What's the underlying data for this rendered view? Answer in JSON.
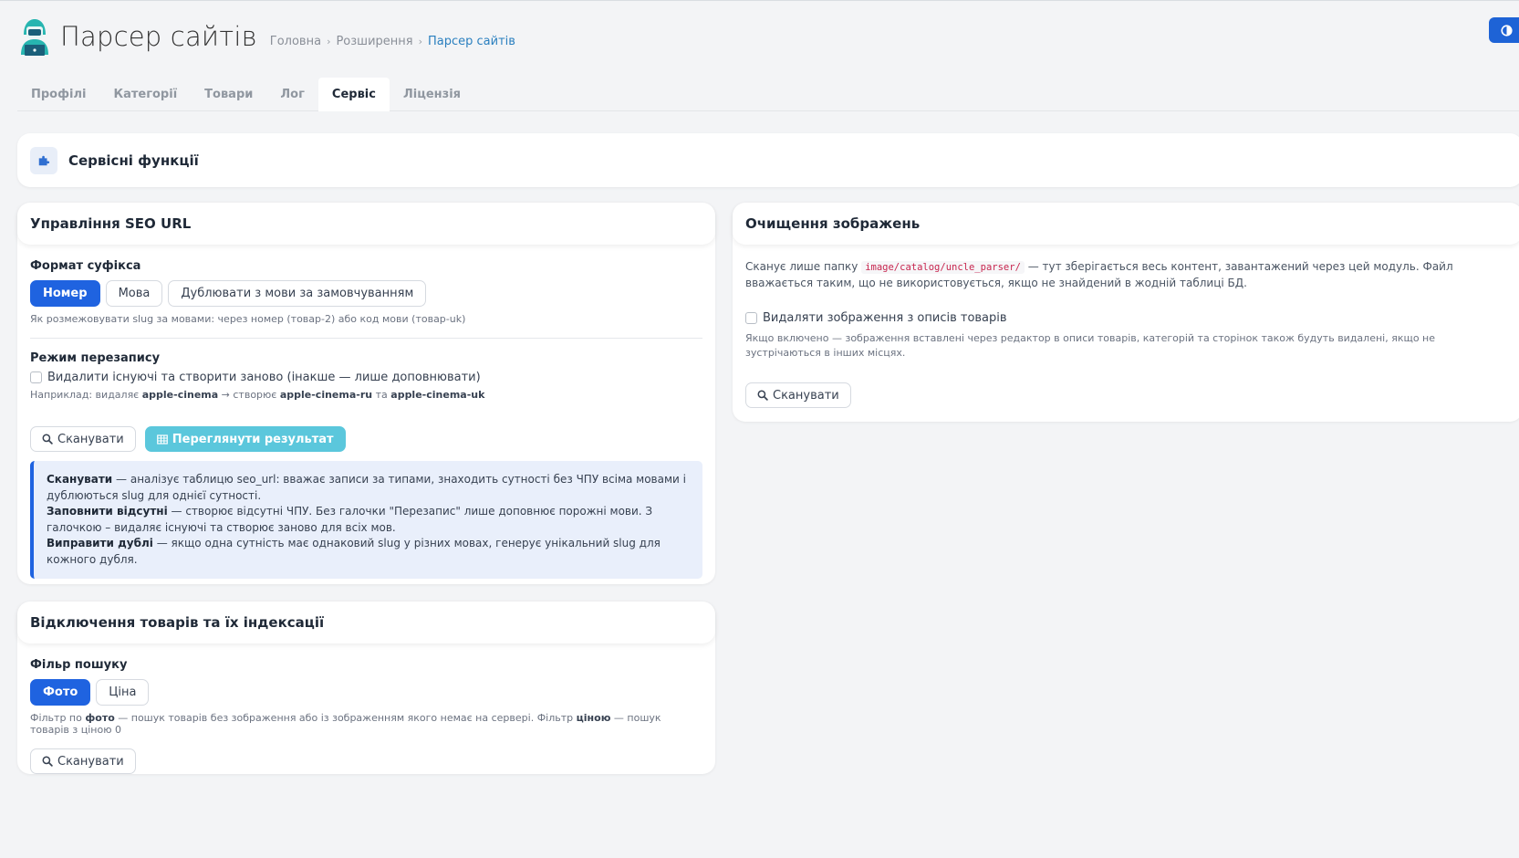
{
  "header": {
    "app_title": "Парсер сайтів",
    "breadcrumb": [
      "Головна",
      "Розширення",
      "Парсер сайтів"
    ]
  },
  "tabs": [
    "Профілі",
    "Категорії",
    "Товари",
    "Лог",
    "Сервіс",
    "Ліцензія"
  ],
  "active_tab": "Сервіс",
  "service": {
    "title": "Сервісні функції"
  },
  "seo": {
    "title": "Управління SEO URL",
    "suffix_label": "Формат суфікса",
    "suffix_options": [
      "Номер",
      "Мова",
      "Дублювати з мови за замовчуванням"
    ],
    "suffix_selected": "Номер",
    "suffix_help": "Як розмежовувати slug за мовами: через номер (товар-2) або код мови (товар-uk)",
    "overwrite_label": "Режим перезапису",
    "overwrite_checkbox": "Видалити існуючі та створити заново (інакше — лише доповнювати)",
    "example_prefix": "Наприклад: видаляє",
    "example_old": "apple-cinema",
    "example_arrow": "→ створює",
    "example_new1": "apple-cinema-ru",
    "example_and": "та",
    "example_new2": "apple-cinema-uk",
    "scan_button": "Сканувати",
    "view_button": "Переглянути результат",
    "info": {
      "scan_title": "Сканувати",
      "scan_text": "— аналізує таблицю seo_url: вважає записи за типами, знаходить сутності без ЧПУ всіма мовами і дублюються slug для однієї сутності.",
      "fill_title": "Заповнити відсутні",
      "fill_text": "— створює відсутні ЧПУ. Без галочки \"Перезапис\" лише доповнює порожні мови. З галочкою – видаляє існуючі та створює заново для всіх мов.",
      "fix_title": "Виправити дублі",
      "fix_text": "— якщо одна сутність має однаковий slug у різних мовах, генерує унікальний slug для кожного дубля."
    }
  },
  "disable": {
    "title": "Відключення товарів та їх індексації",
    "filter_label": "Фільр пошуку",
    "filter_options": [
      "Фото",
      "Ціна"
    ],
    "filter_selected": "Фото",
    "help_1": "Фільтр по",
    "help_photo": "фото",
    "help_2": "— пошук товарів без зображення або із зображенням якого немає на сервері. Фільтр",
    "help_price": "ціною",
    "help_3": "— пошук товарів з ціною 0",
    "scan_button": "Сканувати"
  },
  "images": {
    "title": "Очищення зображень",
    "text_1": "Сканує лише папку",
    "path": "image/catalog/uncle_parser/",
    "text_2": "— тут зберігається весь контент, завантажений через цей модуль. Файл вважається таким, що не використовується, якщо не знайдений в жодній таблиці БД.",
    "checkbox": "Видаляти зображення з описів товарів",
    "checkbox_help": "Якщо включено — зображення вставлені через редактор в описи товарів, категорій та сторінок також будуть видалені, якщо не зустрічаються в інших місцях.",
    "scan_button": "Сканувати"
  },
  "colors": {
    "primary": "#1f63e0",
    "info": "#5bc7dc",
    "code": "#c7254e"
  }
}
